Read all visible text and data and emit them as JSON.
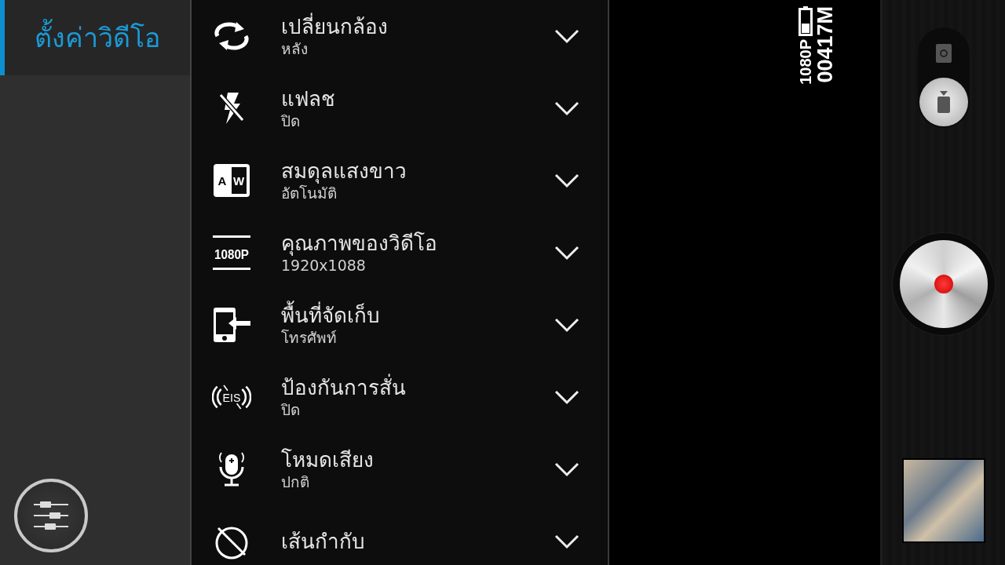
{
  "sidebar": {
    "title": "ตั้งค่าวิดีโอ"
  },
  "settings": [
    {
      "kind": "switch",
      "title": "เปลี่ยนกล้อง",
      "value": "หลัง"
    },
    {
      "kind": "flash",
      "title": "แฟลช",
      "value": "ปิด"
    },
    {
      "kind": "balance",
      "icon_text": [
        "A",
        "W"
      ],
      "title": "สมดุลแสงขาว",
      "value": "อัตโนมัติ"
    },
    {
      "kind": "quality",
      "icon_text": [
        "1080P"
      ],
      "title": "คุณภาพของวิดีโอ",
      "value": "1920x1088"
    },
    {
      "kind": "storage",
      "title": "พื้นที่จัดเก็บ",
      "value": "โทรศัพท์"
    },
    {
      "kind": "stabilizer",
      "icon_text": [
        "EIS"
      ],
      "title": "ป้องกันการสั่น",
      "value": "ปิด"
    },
    {
      "kind": "audio",
      "title": "โหมดเสียง",
      "value": "ปกติ"
    },
    {
      "kind": "grid",
      "title": "เส้นกำกับ"
    }
  ],
  "viewfinder": {
    "resolution": "1080P",
    "remaining": "00417M"
  },
  "modes": [
    {
      "kind": "photo",
      "selected": false
    },
    {
      "kind": "video",
      "selected": true
    }
  ]
}
